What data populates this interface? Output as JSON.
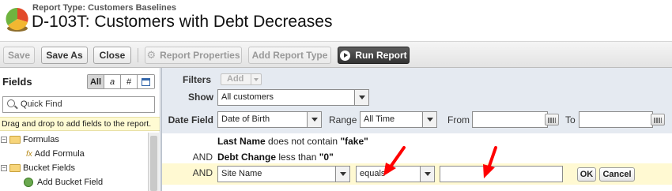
{
  "header": {
    "report_type": "Report Type: Customers Baselines",
    "title": "D-103T: Customers with Debt Decreases"
  },
  "toolbar": {
    "save": "Save",
    "save_as": "Save As",
    "close": "Close",
    "report_properties": "Report Properties",
    "add_report_type": "Add Report Type",
    "run_report": "Run Report"
  },
  "fields": {
    "title": "Fields",
    "type_filters": [
      "All",
      "a",
      "#",
      "cal-icon"
    ],
    "quick_find_placeholder": "Quick Find",
    "hint": "Drag and drop to add fields to the report.",
    "tree": [
      {
        "label": "Formulas"
      },
      {
        "label": "Add Formula"
      },
      {
        "label": "Bucket Fields"
      },
      {
        "label": "Add Bucket Field"
      }
    ]
  },
  "filters": {
    "filters_label": "Filters",
    "add_label": "Add",
    "show_label": "Show",
    "show_value": "All customers",
    "date_field_label": "Date Field",
    "date_field_value": "Date of Birth",
    "range_label": "Range",
    "range_value": "All Time",
    "from_label": "From",
    "to_label": "To",
    "criteria": [
      {
        "prefix": "",
        "field": "Last Name",
        "op": " does not contain ",
        "value": "\"fake\""
      },
      {
        "prefix": "AND",
        "field": "Debt Change",
        "op": " less than ",
        "value": "\"0\""
      }
    ],
    "edit_row": {
      "prefix": "AND",
      "field_value": "Site Name",
      "operator_value": "equals",
      "value_input": "",
      "ok": "OK",
      "cancel": "Cancel"
    }
  },
  "colors": {
    "annotation_arrow": "#ff0000",
    "filter_band": "#e5eaf1",
    "edit_row_bg": "#fff9d2"
  }
}
